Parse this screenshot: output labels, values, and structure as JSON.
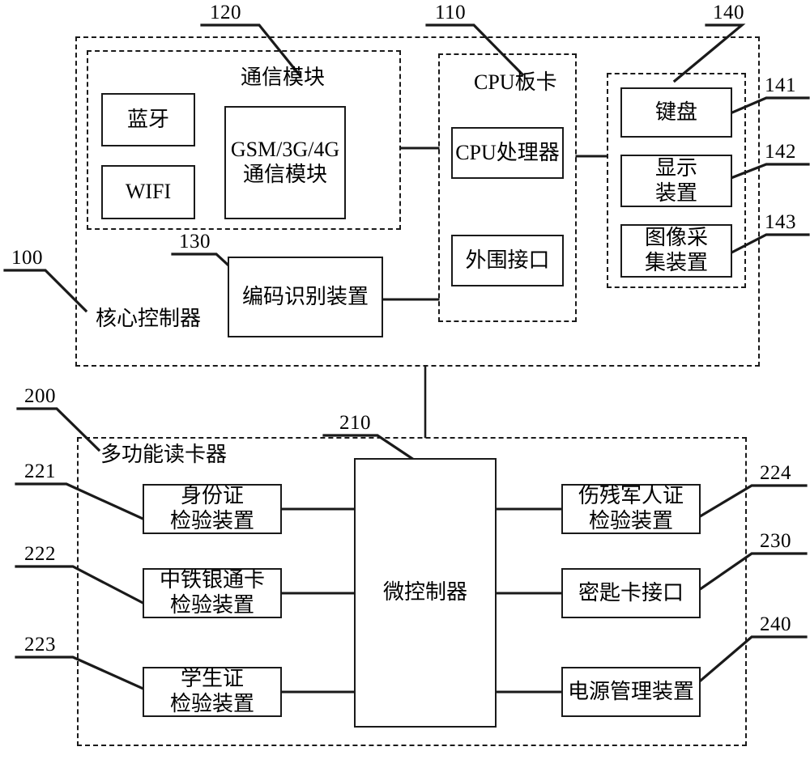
{
  "diagram": {
    "title": "",
    "core_controller": {
      "ref": "100",
      "label": "核心控制器",
      "communication_module": {
        "ref": "120",
        "label": "通信模块",
        "blocks": [
          {
            "label": "蓝牙"
          },
          {
            "label": "WIFI"
          },
          {
            "label": "GSM/3G/4G\n通信模块"
          }
        ]
      },
      "cpu_board": {
        "ref": "110",
        "label": "CPU板卡",
        "blocks": [
          {
            "label": "CPU处理器"
          },
          {
            "label": "外围接口"
          }
        ]
      },
      "peripherals": {
        "ref": "140",
        "blocks": [
          {
            "ref": "141",
            "label": "键盘"
          },
          {
            "ref": "142",
            "label": "显示\n装置"
          },
          {
            "ref": "143",
            "label": "图像采\n集装置"
          }
        ]
      },
      "code_recognition": {
        "ref": "130",
        "label": "编码识别装置"
      }
    },
    "card_reader": {
      "ref": "200",
      "label": "多功能读卡器",
      "controller": {
        "ref": "210",
        "label": "微控制器"
      },
      "left_blocks": [
        {
          "ref": "221",
          "label": "身份证\n检验装置"
        },
        {
          "ref": "222",
          "label": "中铁银通卡\n检验装置"
        },
        {
          "ref": "223",
          "label": "学生证\n检验装置"
        }
      ],
      "right_blocks": [
        {
          "ref": "224",
          "label": "伤残军人证\n检验装置"
        },
        {
          "ref": "230",
          "label": "密匙卡接口"
        },
        {
          "ref": "240",
          "label": "电源管理装置"
        }
      ]
    }
  },
  "colors": {
    "stroke": "#1a1a1a",
    "background": "#ffffff"
  }
}
